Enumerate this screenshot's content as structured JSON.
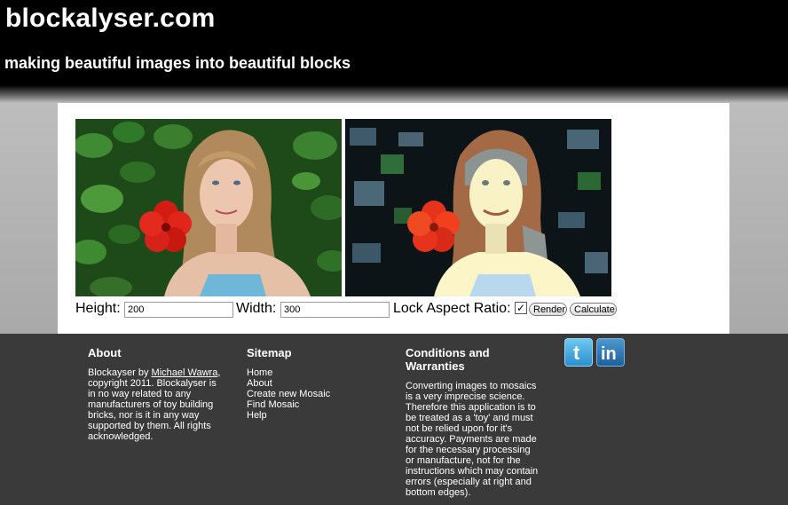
{
  "header": {
    "title": "blockalyser.com",
    "tagline": "making beautiful images into beautiful blocks"
  },
  "images": {
    "original_alt": "Portrait photo of a woman with a red hibiscus flower",
    "mosaic_alt": "Blocky posterized version of the portrait"
  },
  "controls": {
    "height_label": "Height:",
    "height_value": "200",
    "width_label": "Width:",
    "width_value": "300",
    "lock_label": "Lock Aspect Ratio:",
    "lock_checked": true,
    "render_label": "Render",
    "calculate_label": "Calculate"
  },
  "footer": {
    "about": {
      "heading": "About",
      "prefix": "Blockayser by ",
      "author_link": "Michael Wawra",
      "suffix": ", copyright 2011. Blockalyser is in no way related to any manufacturers of toy building bricks, nor is it in any way supported by them. All rights acknowledged."
    },
    "sitemap": {
      "heading": "Sitemap",
      "links": [
        "Home",
        "About",
        "Create new Mosaic",
        "Find Mosaic",
        "Help"
      ]
    },
    "conditions": {
      "heading": "Conditions and Warranties",
      "text": "Converting images to mosaics is a very imprecise science. Therefore this application is to be treated as a 'toy' and must not be relied upon for it's accuracy. Payments are made for the necessary processing or manufacture, not for the instructions which may contain errors (especially at right and bottom edges)."
    },
    "social": {
      "twitter_icon": "twitter-icon",
      "twitter_glyph": "t",
      "linkedin_icon": "linkedin-icon",
      "linkedin_glyph": "in"
    }
  }
}
